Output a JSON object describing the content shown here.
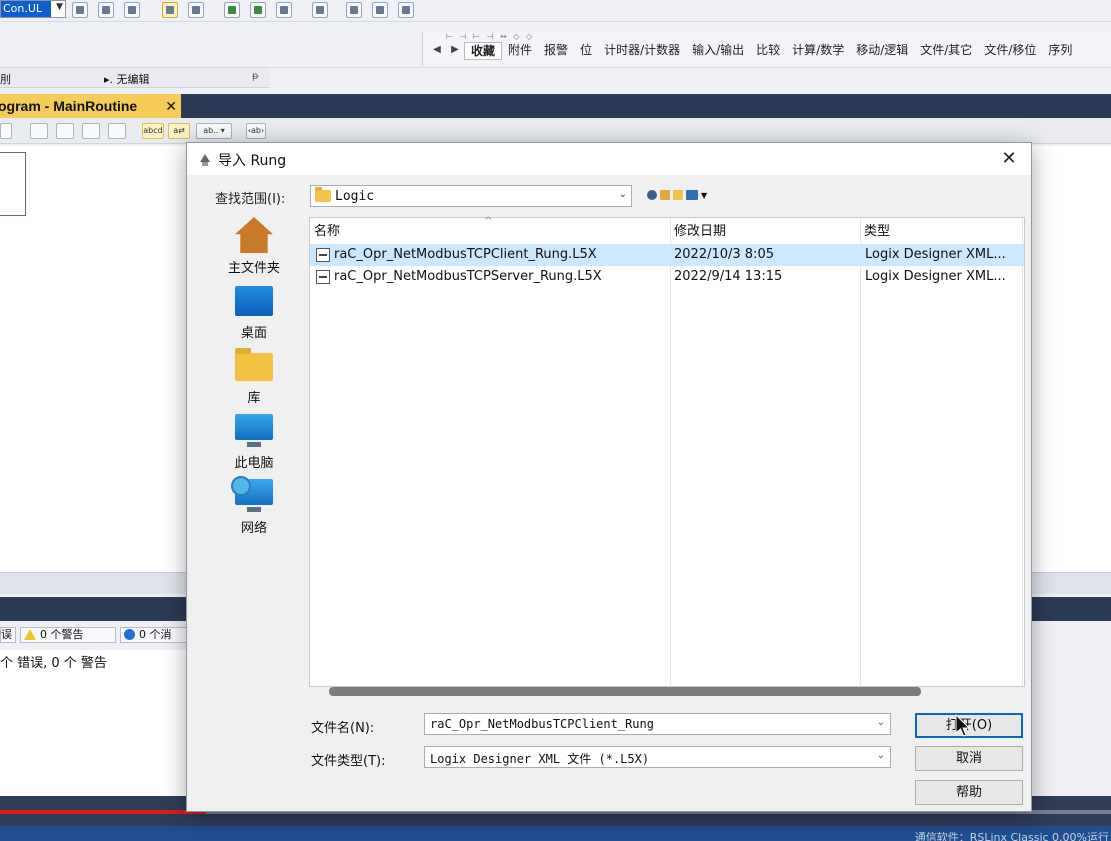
{
  "toolbar": {
    "project_combo_value": "Con.UL"
  },
  "instructions": {
    "tabs": [
      "收藏",
      "附件",
      "报警",
      "位",
      "计时器/计数器",
      "输入/输出",
      "比较",
      "计算/数学",
      "移动/逻辑",
      "文件/其它",
      "文件/移位",
      "序列"
    ]
  },
  "panel_row": {
    "left_text": "刖",
    "edit_state": "无编辑"
  },
  "document_tab": {
    "title": "ogram - MainRoutine",
    "close": "✕"
  },
  "errors_bar": {
    "errors_chip": "误",
    "warnings_chip": "0 个警告",
    "info_chip": "0 个消"
  },
  "output": {
    "summary": "个 错误, 0 个 警告"
  },
  "status_bar": {
    "text": "通信软件：RSLinx Classic   0.00%运行"
  },
  "video": {
    "progress": 0.185
  },
  "dialog": {
    "title": "导入 Rung",
    "close": "✕",
    "look_in_label": "查找范围(I):",
    "look_in_value": "Logic",
    "places": [
      {
        "label": "主文件夹",
        "icon": "home-icon"
      },
      {
        "label": "桌面",
        "icon": "desktop-icon"
      },
      {
        "label": "库",
        "icon": "library-icon"
      },
      {
        "label": "此电脑",
        "icon": "computer-icon"
      },
      {
        "label": "网络",
        "icon": "network-icon"
      }
    ],
    "columns": {
      "name": "名称",
      "date": "修改日期",
      "type": "类型"
    },
    "files": [
      {
        "name": "raC_Opr_NetModbusTCPClient_Rung.L5X",
        "date": "2022/10/3 8:05",
        "type": "Logix Designer XML..."
      },
      {
        "name": "raC_Opr_NetModbusTCPServer_Rung.L5X",
        "date": "2022/9/14 13:15",
        "type": "Logix Designer XML..."
      }
    ],
    "file_name_label": "文件名(N):",
    "file_name_value": "raC_Opr_NetModbusTCPClient_Rung",
    "file_type_label": "文件类型(T):",
    "file_type_value": "Logix Designer XML 文件 (*.L5X)",
    "buttons": {
      "open": "打开(O)",
      "cancel": "取消",
      "help": "帮助"
    }
  }
}
